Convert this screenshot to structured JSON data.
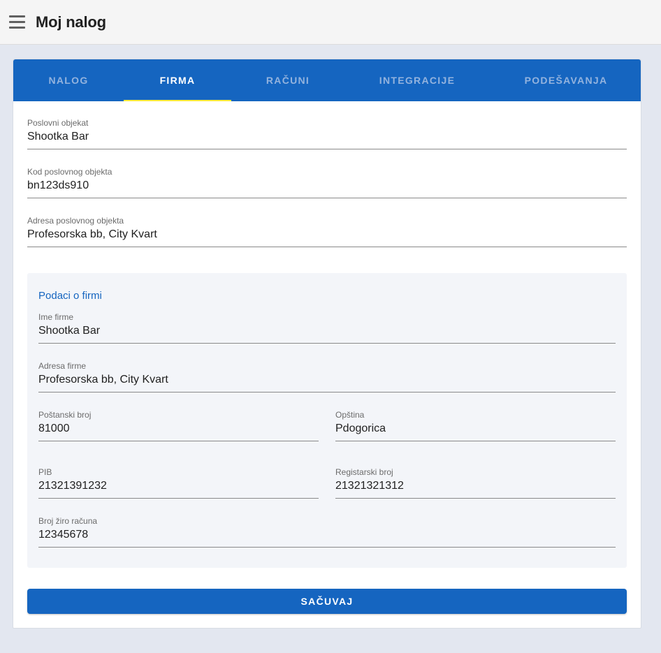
{
  "header": {
    "title": "Moj nalog",
    "menu_icon": "hamburger-menu-icon"
  },
  "tabs": [
    {
      "label": "NALOG",
      "active": false
    },
    {
      "label": "FIRMA",
      "active": true
    },
    {
      "label": "RAČUNI",
      "active": false
    },
    {
      "label": "INTEGRACIJE",
      "active": false
    },
    {
      "label": "PODEŠAVANJA",
      "active": false
    }
  ],
  "business_unit": {
    "name": {
      "label": "Poslovni objekat",
      "value": "Shootka Bar"
    },
    "code": {
      "label": "Kod poslovnog objekta",
      "value": "bn123ds910"
    },
    "address": {
      "label": "Adresa poslovnog objekta",
      "value": "Profesorska bb, City Kvart"
    }
  },
  "company": {
    "section_title": "Podaci o firmi",
    "name": {
      "label": "Ime firme",
      "value": "Shootka Bar"
    },
    "address": {
      "label": "Adresa firme",
      "value": "Profesorska bb, City Kvart"
    },
    "postal_code": {
      "label": "Poštanski broj",
      "value": "81000"
    },
    "municipality": {
      "label": "Opština",
      "value": "Pdogorica"
    },
    "pib": {
      "label": "PIB",
      "value": "21321391232"
    },
    "registration_number": {
      "label": "Registarski broj",
      "value": "21321321312"
    },
    "bank_account": {
      "label": "Broj žiro računa",
      "value": "12345678"
    }
  },
  "actions": {
    "save_label": "SAČUVAJ"
  },
  "colors": {
    "primary": "#1565c0",
    "tab_indicator": "#ffeb3b",
    "background": "#e3e7f0"
  }
}
